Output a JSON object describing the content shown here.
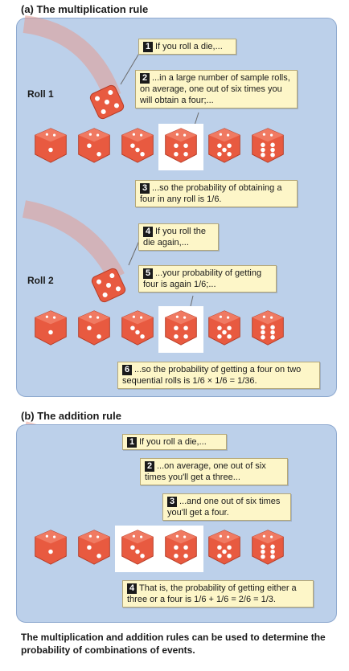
{
  "section_a": {
    "heading": "(a) The multiplication rule",
    "roll1_label": "Roll 1",
    "roll2_label": "Roll 2",
    "callouts": [
      {
        "num": "1",
        "text": "If you roll a die,..."
      },
      {
        "num": "2",
        "text": "...in a large number of sample rolls, on average, one out of six times you will obtain a four;..."
      },
      {
        "num": "3",
        "text": "...so the probability of obtaining a four in any roll is 1/6."
      },
      {
        "num": "4",
        "text": "If you roll the die again,..."
      },
      {
        "num": "5",
        "text": "...your probability of getting four is again 1/6;..."
      },
      {
        "num": "6",
        "text": "...so the probability of getting a four on two sequential rolls is 1/6 × 1/6 = 1/36."
      }
    ],
    "dice_row1": [
      1,
      2,
      3,
      4,
      5,
      6
    ],
    "dice_row2": [
      1,
      2,
      3,
      4,
      5,
      6
    ],
    "highlighted_face": 4
  },
  "section_b": {
    "heading": "(b) The addition rule",
    "callouts": [
      {
        "num": "1",
        "text": "If you roll a die,..."
      },
      {
        "num": "2",
        "text": "...on average, one out of six times you'll get a three..."
      },
      {
        "num": "3",
        "text": "...and one out of six times you'll get a four."
      },
      {
        "num": "4",
        "text": "That is, the probability of getting either a three or a four is 1/6 + 1/6 = 2/6 = 1/3."
      }
    ],
    "dice_row": [
      1,
      2,
      3,
      4,
      5,
      6
    ],
    "highlighted_faces": [
      3,
      4
    ]
  },
  "caption": "The multiplication and addition rules can be used to determine the probability of combinations of events.",
  "colors": {
    "panel": "#bcd0ea",
    "die": "#e85a40",
    "callout": "#fdf6c8"
  }
}
